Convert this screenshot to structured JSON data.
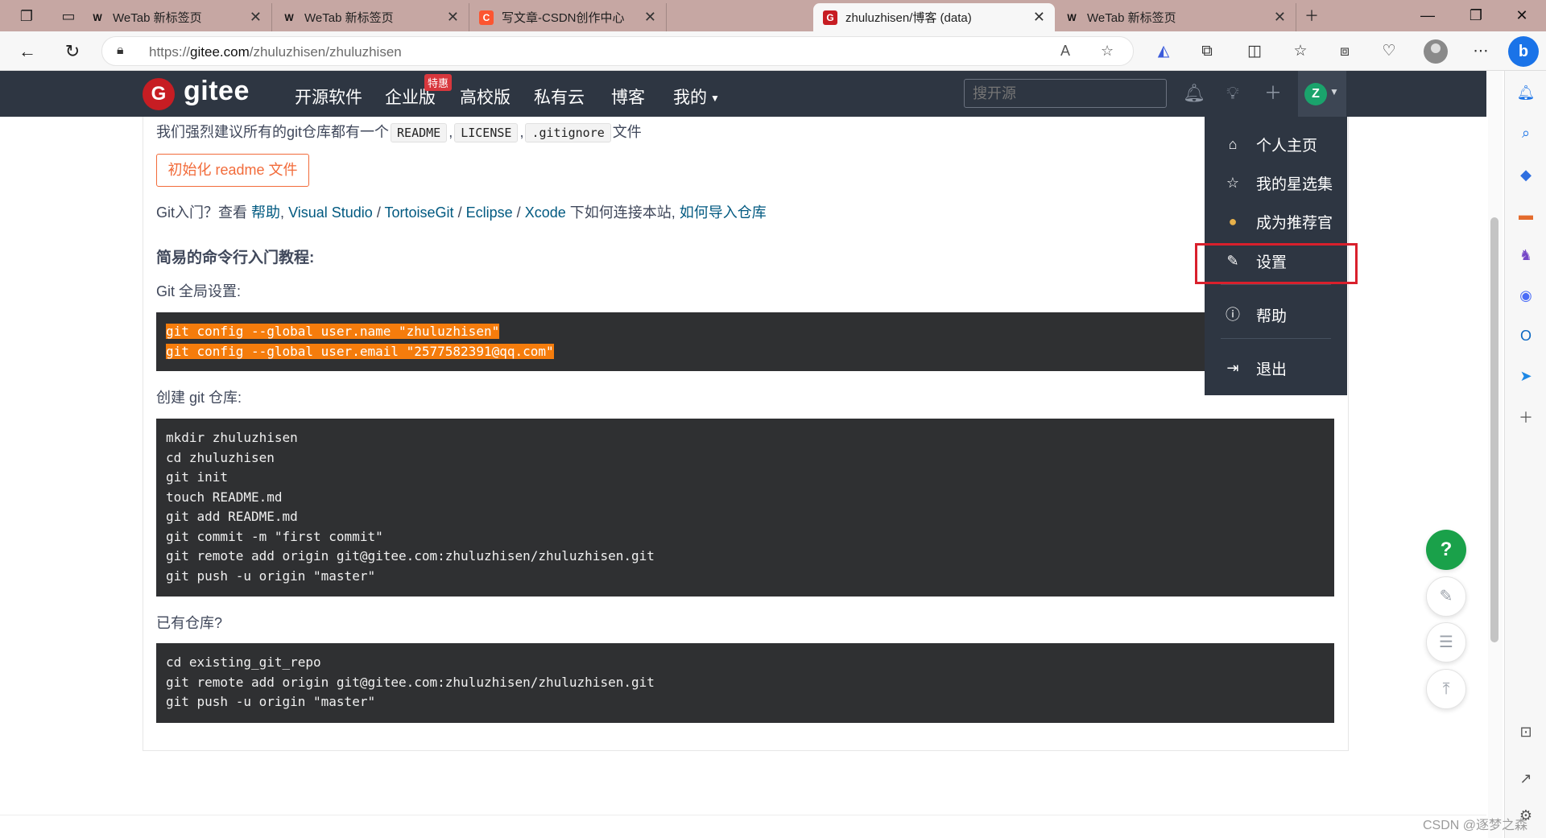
{
  "browser": {
    "tabs": [
      {
        "title": "WeTab 新标签页",
        "favicon": "wetab-icon",
        "active": false
      },
      {
        "title": "WeTab 新标签页",
        "favicon": "wetab-icon",
        "active": false
      },
      {
        "title": "写文章-CSDN创作中心",
        "favicon": "csdn-icon",
        "active": false
      },
      {
        "title": "zhuluzhisen/博客 (data)",
        "favicon": "gitee-icon",
        "active": true
      },
      {
        "title": "WeTab 新标签页",
        "favicon": "wetab-icon",
        "active": false
      }
    ],
    "url_prefix": "https://",
    "url_host": "gitee.com",
    "url_path": "/zhuluzhisen/zhuluzhisen"
  },
  "gitee": {
    "logo_text": "gitee",
    "nav": [
      "开源软件",
      "企业版",
      "高校版",
      "私有云",
      "博客",
      "我的"
    ],
    "hot_badge": "特惠",
    "search_placeholder": "搜开源",
    "avatar_letter": "Z"
  },
  "content": {
    "intro_prefix": "我们强烈建议所有的git仓库都有一个",
    "intro_chips": [
      "README",
      "LICENSE",
      ".gitignore"
    ],
    "intro_suffix": "文件",
    "intro_sep": ",",
    "init_button": "初始化 readme 文件",
    "git_help_prefix": "Git入门？查看",
    "git_help_links": [
      "帮助",
      "Visual Studio",
      "TortoiseGit",
      "Eclipse",
      "Xcode"
    ],
    "git_help_middle": "下如何连接本站,",
    "git_help_import": "如何导入仓库",
    "link_sep_comma": ",",
    "link_sep_slash": "/",
    "tutorial_heading": "简易的命令行入门教程:",
    "global_settings_label": "Git 全局设置:",
    "global_settings_code": [
      "git config --global user.name \"zhuluzhisen\"",
      "git config --global user.email \"2577582391@qq.com\""
    ],
    "create_repo_label": "创建 git 仓库:",
    "create_repo_code": [
      "mkdir zhuluzhisen",
      "cd zhuluzhisen",
      "git init",
      "touch README.md",
      "git add README.md",
      "git commit -m \"first commit\"",
      "git remote add origin git@gitee.com:zhuluzhisen/zhuluzhisen.git",
      "git push -u origin \"master\""
    ],
    "existing_repo_label": "已有仓库?",
    "existing_repo_code": [
      "cd existing_git_repo",
      "git remote add origin git@gitee.com:zhuluzhisen/zhuluzhisen.git",
      "git push -u origin \"master\""
    ]
  },
  "dropdown": {
    "items": [
      {
        "label": "个人主页",
        "icon": "home-icon"
      },
      {
        "label": "我的星选集",
        "icon": "star-icon"
      },
      {
        "label": "成为推荐官",
        "icon": "coin-icon"
      },
      {
        "label": "设置",
        "icon": "edit-icon"
      },
      {
        "label": "帮助",
        "icon": "help-icon"
      },
      {
        "label": "退出",
        "icon": "logout-icon"
      }
    ],
    "highlighted": "设置"
  },
  "floating": {
    "help": "?"
  },
  "watermark": "CSDN @逐梦之森",
  "colors": {
    "highlight_box": "#d9202c",
    "gitee_red": "#c71d23",
    "nav_bg": "#2e3642",
    "code_highlight": "#f57c0c"
  }
}
